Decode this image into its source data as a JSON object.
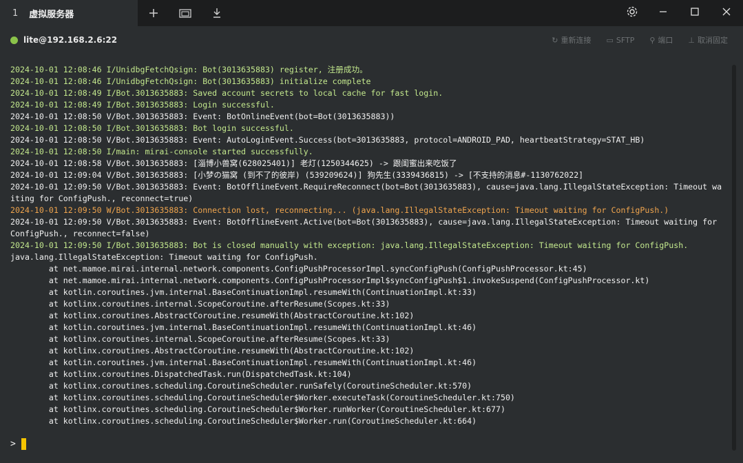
{
  "tab": {
    "index": "1",
    "title": "虚拟服务器"
  },
  "toolbar_icons": [
    "plus-icon",
    "window-icon",
    "download-icon"
  ],
  "window_controls": [
    "settings-icon",
    "minimize-icon",
    "maximize-icon",
    "close-icon"
  ],
  "session": {
    "host": "lite@192.168.2.6:22",
    "status_color": "#8bc34a",
    "actions": [
      {
        "icon": "reconnect-icon",
        "glyph": "↻",
        "label": "重新连接"
      },
      {
        "icon": "sftp-icon",
        "glyph": "▭",
        "label": "SFTP"
      },
      {
        "icon": "plug-icon",
        "glyph": "⚲",
        "label": "端口"
      },
      {
        "icon": "pin-icon",
        "glyph": "⊥",
        "label": "取消固定"
      }
    ]
  },
  "log_lines": [
    {
      "text": "2024-10-01 12:08:46 I/UnidbgFetchQsign: Bot(3013635883) register, 注册成功。",
      "color": "green"
    },
    {
      "text": "2024-10-01 12:08:46 I/UnidbgFetchQsign: Bot(3013635883) initialize complete",
      "color": "green"
    },
    {
      "text": "2024-10-01 12:08:49 I/Bot.3013635883: Saved account secrets to local cache for fast login.",
      "color": "green"
    },
    {
      "text": "2024-10-01 12:08:49 I/Bot.3013635883: Login successful.",
      "color": "green"
    },
    {
      "text": "2024-10-01 12:08:50 V/Bot.3013635883: Event: BotOnlineEvent(bot=Bot(3013635883))",
      "color": "white"
    },
    {
      "text": "2024-10-01 12:08:50 I/Bot.3013635883: Bot login successful.",
      "color": "green"
    },
    {
      "text": "2024-10-01 12:08:50 V/Bot.3013635883: Event: AutoLoginEvent.Success(bot=3013635883, protocol=ANDROID_PAD, heartbeatStrategy=STAT_HB)",
      "color": "white"
    },
    {
      "text": "2024-10-01 12:08:50 I/main: mirai-console started successfully.",
      "color": "green"
    },
    {
      "text": "2024-10-01 12:08:58 V/Bot.3013635883: [淄博小兽窝(628025401)] 老灯(1250344625) -> 跟闺蜜出来吃饭了",
      "color": "white"
    },
    {
      "text": "2024-10-01 12:09:04 V/Bot.3013635883: [小梦の猫窝 (到不了的彼岸) (539209624)] 狗先生(3339436815) -> [不支持的消息#-1130762022]",
      "color": "white"
    },
    {
      "text": "2024-10-01 12:09:50 V/Bot.3013635883: Event: BotOfflineEvent.RequireReconnect(bot=Bot(3013635883), cause=java.lang.IllegalStateException: Timeout wa",
      "color": "white"
    },
    {
      "text": "iting for ConfigPush., reconnect=true)",
      "color": "white"
    },
    {
      "text": "2024-10-01 12:09:50 W/Bot.3013635883: Connection lost, reconnecting... (java.lang.IllegalStateException: Timeout waiting for ConfigPush.)",
      "color": "orange"
    },
    {
      "text": "2024-10-01 12:09:50 V/Bot.3013635883: Event: BotOfflineEvent.Active(bot=Bot(3013635883), cause=java.lang.IllegalStateException: Timeout waiting for",
      "color": "white"
    },
    {
      "text": "ConfigPush., reconnect=false)",
      "color": "white"
    },
    {
      "text": "2024-10-01 12:09:50 I/Bot.3013635883: Bot is closed manually with exception: java.lang.IllegalStateException: Timeout waiting for ConfigPush.",
      "color": "green"
    },
    {
      "text": "java.lang.IllegalStateException: Timeout waiting for ConfigPush.",
      "color": "white"
    },
    {
      "text": "        at net.mamoe.mirai.internal.network.components.ConfigPushProcessorImpl.syncConfigPush(ConfigPushProcessor.kt:45)",
      "color": "white"
    },
    {
      "text": "        at net.mamoe.mirai.internal.network.components.ConfigPushProcessorImpl$syncConfigPush$1.invokeSuspend(ConfigPushProcessor.kt)",
      "color": "white"
    },
    {
      "text": "        at kotlin.coroutines.jvm.internal.BaseContinuationImpl.resumeWith(ContinuationImpl.kt:33)",
      "color": "white"
    },
    {
      "text": "        at kotlinx.coroutines.internal.ScopeCoroutine.afterResume(Scopes.kt:33)",
      "color": "white"
    },
    {
      "text": "        at kotlinx.coroutines.AbstractCoroutine.resumeWith(AbstractCoroutine.kt:102)",
      "color": "white"
    },
    {
      "text": "        at kotlin.coroutines.jvm.internal.BaseContinuationImpl.resumeWith(ContinuationImpl.kt:46)",
      "color": "white"
    },
    {
      "text": "        at kotlinx.coroutines.internal.ScopeCoroutine.afterResume(Scopes.kt:33)",
      "color": "white"
    },
    {
      "text": "        at kotlinx.coroutines.AbstractCoroutine.resumeWith(AbstractCoroutine.kt:102)",
      "color": "white"
    },
    {
      "text": "        at kotlin.coroutines.jvm.internal.BaseContinuationImpl.resumeWith(ContinuationImpl.kt:46)",
      "color": "white"
    },
    {
      "text": "        at kotlinx.coroutines.DispatchedTask.run(DispatchedTask.kt:104)",
      "color": "white"
    },
    {
      "text": "        at kotlinx.coroutines.scheduling.CoroutineScheduler.runSafely(CoroutineScheduler.kt:570)",
      "color": "white"
    },
    {
      "text": "        at kotlinx.coroutines.scheduling.CoroutineScheduler$Worker.executeTask(CoroutineScheduler.kt:750)",
      "color": "white"
    },
    {
      "text": "        at kotlinx.coroutines.scheduling.CoroutineScheduler$Worker.runWorker(CoroutineScheduler.kt:677)",
      "color": "white"
    },
    {
      "text": "        at kotlinx.coroutines.scheduling.CoroutineScheduler$Worker.run(CoroutineScheduler.kt:664)",
      "color": "white"
    }
  ],
  "prompt": {
    "symbol": ">",
    "cursor_color": "#f5c400"
  },
  "colors": {
    "green": "#c3e88d",
    "white": "#f0f0f0",
    "orange": "#f0a54e",
    "background": "#2b2e30"
  }
}
